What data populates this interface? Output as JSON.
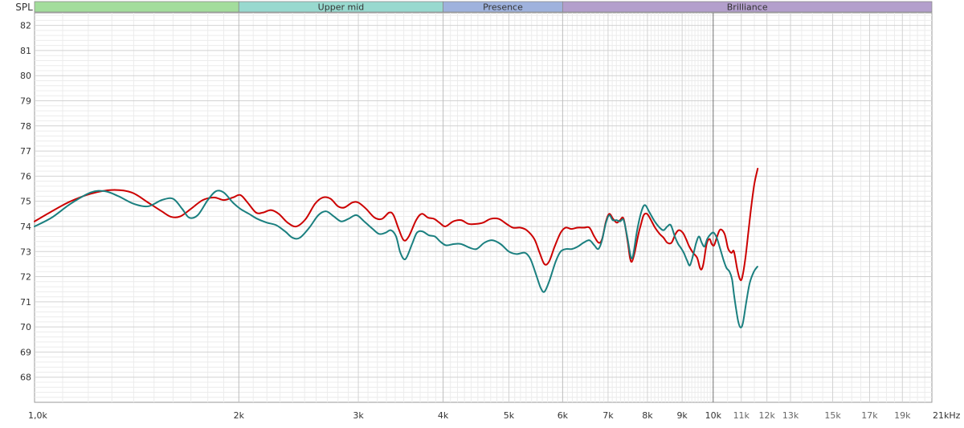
{
  "chart_data": {
    "type": "line",
    "x_scale": "log",
    "xlim": [
      1000,
      21000
    ],
    "ylim": [
      67,
      82.5
    ],
    "ylabel": "SPL",
    "x_unit": "kHz",
    "grid": true,
    "bands": [
      {
        "label": "",
        "from": 1000,
        "to": 2000,
        "color": "#a3dd9c"
      },
      {
        "label": "Upper mid",
        "from": 2000,
        "to": 4000,
        "color": "#98d9cf"
      },
      {
        "label": "Presence",
        "from": 4000,
        "to": 6000,
        "color": "#9fb2dd"
      },
      {
        "label": "Brilliance",
        "from": 6000,
        "to": 21000,
        "color": "#b39fcc"
      }
    ],
    "x_ticks": [
      {
        "value": 1000,
        "label": "1,0k"
      },
      {
        "value": 2000,
        "label": "2k"
      },
      {
        "value": 3000,
        "label": "3k"
      },
      {
        "value": 4000,
        "label": "4k"
      },
      {
        "value": 5000,
        "label": "5k"
      },
      {
        "value": 6000,
        "label": "6k"
      },
      {
        "value": 7000,
        "label": "7k"
      },
      {
        "value": 8000,
        "label": "8k"
      },
      {
        "value": 9000,
        "label": "9k"
      },
      {
        "value": 10000,
        "label": "10k"
      },
      {
        "value": 11000,
        "label": "11k"
      },
      {
        "value": 12000,
        "label": "12k"
      },
      {
        "value": 13000,
        "label": "13k"
      },
      {
        "value": 15000,
        "label": "15k"
      },
      {
        "value": 17000,
        "label": "17k"
      },
      {
        "value": 19000,
        "label": "19k"
      },
      {
        "value": 21000,
        "label": "21kHz"
      }
    ],
    "y_ticks": [
      {
        "value": 68,
        "label": "68"
      },
      {
        "value": 69,
        "label": "69"
      },
      {
        "value": 70,
        "label": "70"
      },
      {
        "value": 71,
        "label": "71"
      },
      {
        "value": 72,
        "label": "72"
      },
      {
        "value": 73,
        "label": "73"
      },
      {
        "value": 74,
        "label": "74"
      },
      {
        "value": 75,
        "label": "75"
      },
      {
        "value": 76,
        "label": "76"
      },
      {
        "value": 77,
        "label": "77"
      },
      {
        "value": 78,
        "label": "78"
      },
      {
        "value": 79,
        "label": "79"
      },
      {
        "value": 80,
        "label": "80"
      },
      {
        "value": 81,
        "label": "81"
      },
      {
        "value": 82,
        "label": "82"
      }
    ],
    "series": [
      {
        "color": "#cc0000",
        "points": [
          [
            1000,
            74.2
          ],
          [
            1060,
            74.6
          ],
          [
            1130,
            75.0
          ],
          [
            1210,
            75.3
          ],
          [
            1300,
            75.45
          ],
          [
            1390,
            75.35
          ],
          [
            1470,
            74.95
          ],
          [
            1540,
            74.6
          ],
          [
            1590,
            74.38
          ],
          [
            1640,
            74.4
          ],
          [
            1700,
            74.7
          ],
          [
            1770,
            75.05
          ],
          [
            1840,
            75.15
          ],
          [
            1900,
            75.05
          ],
          [
            1960,
            75.15
          ],
          [
            2010,
            75.25
          ],
          [
            2060,
            74.95
          ],
          [
            2120,
            74.55
          ],
          [
            2170,
            74.55
          ],
          [
            2230,
            74.65
          ],
          [
            2290,
            74.5
          ],
          [
            2360,
            74.15
          ],
          [
            2430,
            74.0
          ],
          [
            2510,
            74.3
          ],
          [
            2590,
            74.9
          ],
          [
            2660,
            75.15
          ],
          [
            2730,
            75.1
          ],
          [
            2800,
            74.8
          ],
          [
            2860,
            74.75
          ],
          [
            2940,
            74.95
          ],
          [
            3000,
            74.95
          ],
          [
            3080,
            74.7
          ],
          [
            3170,
            74.35
          ],
          [
            3250,
            74.3
          ],
          [
            3330,
            74.55
          ],
          [
            3380,
            74.45
          ],
          [
            3440,
            73.9
          ],
          [
            3500,
            73.45
          ],
          [
            3560,
            73.6
          ],
          [
            3650,
            74.25
          ],
          [
            3720,
            74.5
          ],
          [
            3800,
            74.35
          ],
          [
            3880,
            74.3
          ],
          [
            3950,
            74.15
          ],
          [
            4030,
            74.0
          ],
          [
            4140,
            74.2
          ],
          [
            4250,
            74.25
          ],
          [
            4360,
            74.1
          ],
          [
            4470,
            74.1
          ],
          [
            4580,
            74.15
          ],
          [
            4700,
            74.3
          ],
          [
            4830,
            74.3
          ],
          [
            4960,
            74.1
          ],
          [
            5070,
            73.95
          ],
          [
            5200,
            73.95
          ],
          [
            5310,
            73.85
          ],
          [
            5450,
            73.5
          ],
          [
            5550,
            72.95
          ],
          [
            5640,
            72.5
          ],
          [
            5730,
            72.6
          ],
          [
            5840,
            73.2
          ],
          [
            5960,
            73.75
          ],
          [
            6060,
            73.95
          ],
          [
            6180,
            73.9
          ],
          [
            6310,
            73.95
          ],
          [
            6450,
            73.95
          ],
          [
            6570,
            73.95
          ],
          [
            6680,
            73.6
          ],
          [
            6780,
            73.35
          ],
          [
            6860,
            73.5
          ],
          [
            6950,
            74.2
          ],
          [
            7030,
            74.5
          ],
          [
            7120,
            74.3
          ],
          [
            7210,
            74.15
          ],
          [
            7290,
            74.25
          ],
          [
            7380,
            74.3
          ],
          [
            7480,
            73.4
          ],
          [
            7540,
            72.75
          ],
          [
            7590,
            72.6
          ],
          [
            7660,
            72.95
          ],
          [
            7760,
            73.7
          ],
          [
            7830,
            74.1
          ],
          [
            7900,
            74.45
          ],
          [
            7990,
            74.5
          ],
          [
            8080,
            74.3
          ],
          [
            8210,
            73.95
          ],
          [
            8340,
            73.7
          ],
          [
            8450,
            73.55
          ],
          [
            8560,
            73.35
          ],
          [
            8680,
            73.35
          ],
          [
            8800,
            73.7
          ],
          [
            8900,
            73.85
          ],
          [
            9020,
            73.75
          ],
          [
            9120,
            73.5
          ],
          [
            9220,
            73.2
          ],
          [
            9340,
            72.95
          ],
          [
            9470,
            72.75
          ],
          [
            9560,
            72.35
          ],
          [
            9620,
            72.3
          ],
          [
            9680,
            72.55
          ],
          [
            9780,
            73.3
          ],
          [
            9880,
            73.5
          ],
          [
            9950,
            73.3
          ],
          [
            10030,
            73.25
          ],
          [
            10120,
            73.55
          ],
          [
            10220,
            73.85
          ],
          [
            10310,
            73.85
          ],
          [
            10410,
            73.65
          ],
          [
            10510,
            73.15
          ],
          [
            10580,
            73.0
          ],
          [
            10650,
            72.95
          ],
          [
            10730,
            73.0
          ],
          [
            10850,
            72.3
          ],
          [
            10950,
            71.9
          ],
          [
            11030,
            71.95
          ],
          [
            11150,
            72.7
          ],
          [
            11270,
            73.8
          ],
          [
            11380,
            74.8
          ],
          [
            11500,
            75.7
          ],
          [
            11630,
            76.3
          ]
        ]
      },
      {
        "color": "#1a7f7f",
        "points": [
          [
            1000,
            74.0
          ],
          [
            1060,
            74.35
          ],
          [
            1130,
            74.9
          ],
          [
            1210,
            75.35
          ],
          [
            1270,
            75.4
          ],
          [
            1330,
            75.2
          ],
          [
            1400,
            74.9
          ],
          [
            1470,
            74.8
          ],
          [
            1540,
            75.05
          ],
          [
            1600,
            75.1
          ],
          [
            1650,
            74.7
          ],
          [
            1690,
            74.35
          ],
          [
            1740,
            74.45
          ],
          [
            1800,
            75.05
          ],
          [
            1850,
            75.4
          ],
          [
            1900,
            75.35
          ],
          [
            1960,
            74.95
          ],
          [
            2010,
            74.7
          ],
          [
            2070,
            74.5
          ],
          [
            2130,
            74.3
          ],
          [
            2200,
            74.15
          ],
          [
            2270,
            74.05
          ],
          [
            2340,
            73.8
          ],
          [
            2400,
            73.55
          ],
          [
            2460,
            73.55
          ],
          [
            2540,
            73.95
          ],
          [
            2620,
            74.45
          ],
          [
            2690,
            74.6
          ],
          [
            2760,
            74.4
          ],
          [
            2830,
            74.2
          ],
          [
            2900,
            74.3
          ],
          [
            2980,
            74.45
          ],
          [
            3060,
            74.2
          ],
          [
            3150,
            73.9
          ],
          [
            3220,
            73.7
          ],
          [
            3290,
            73.75
          ],
          [
            3350,
            73.85
          ],
          [
            3410,
            73.6
          ],
          [
            3460,
            72.95
          ],
          [
            3520,
            72.7
          ],
          [
            3600,
            73.3
          ],
          [
            3660,
            73.75
          ],
          [
            3730,
            73.8
          ],
          [
            3810,
            73.65
          ],
          [
            3890,
            73.6
          ],
          [
            3960,
            73.4
          ],
          [
            4040,
            73.25
          ],
          [
            4150,
            73.3
          ],
          [
            4250,
            73.3
          ],
          [
            4380,
            73.15
          ],
          [
            4480,
            73.1
          ],
          [
            4600,
            73.35
          ],
          [
            4720,
            73.45
          ],
          [
            4860,
            73.3
          ],
          [
            5000,
            73.0
          ],
          [
            5130,
            72.9
          ],
          [
            5280,
            72.95
          ],
          [
            5380,
            72.7
          ],
          [
            5480,
            72.1
          ],
          [
            5570,
            71.55
          ],
          [
            5640,
            71.4
          ],
          [
            5730,
            71.8
          ],
          [
            5860,
            72.6
          ],
          [
            5960,
            73.0
          ],
          [
            6070,
            73.1
          ],
          [
            6190,
            73.1
          ],
          [
            6320,
            73.2
          ],
          [
            6440,
            73.35
          ],
          [
            6570,
            73.45
          ],
          [
            6680,
            73.25
          ],
          [
            6770,
            73.1
          ],
          [
            6850,
            73.4
          ],
          [
            6950,
            74.15
          ],
          [
            7030,
            74.45
          ],
          [
            7110,
            74.25
          ],
          [
            7200,
            74.25
          ],
          [
            7290,
            74.2
          ],
          [
            7380,
            74.25
          ],
          [
            7480,
            73.5
          ],
          [
            7560,
            72.8
          ],
          [
            7620,
            72.85
          ],
          [
            7720,
            73.8
          ],
          [
            7830,
            74.55
          ],
          [
            7930,
            74.85
          ],
          [
            8060,
            74.55
          ],
          [
            8200,
            74.2
          ],
          [
            8340,
            73.95
          ],
          [
            8450,
            73.85
          ],
          [
            8560,
            74.0
          ],
          [
            8660,
            74.05
          ],
          [
            8780,
            73.6
          ],
          [
            8880,
            73.3
          ],
          [
            8960,
            73.15
          ],
          [
            9050,
            72.95
          ],
          [
            9150,
            72.65
          ],
          [
            9240,
            72.45
          ],
          [
            9350,
            72.9
          ],
          [
            9440,
            73.35
          ],
          [
            9530,
            73.6
          ],
          [
            9620,
            73.35
          ],
          [
            9710,
            73.2
          ],
          [
            9800,
            73.5
          ],
          [
            9920,
            73.7
          ],
          [
            10020,
            73.75
          ],
          [
            10120,
            73.55
          ],
          [
            10230,
            73.15
          ],
          [
            10360,
            72.65
          ],
          [
            10460,
            72.35
          ],
          [
            10570,
            72.2
          ],
          [
            10660,
            71.9
          ],
          [
            10730,
            71.3
          ],
          [
            10810,
            70.7
          ],
          [
            10890,
            70.2
          ],
          [
            10970,
            69.98
          ],
          [
            11060,
            70.15
          ],
          [
            11190,
            71.0
          ],
          [
            11320,
            71.75
          ],
          [
            11480,
            72.2
          ],
          [
            11620,
            72.4
          ]
        ]
      }
    ]
  }
}
